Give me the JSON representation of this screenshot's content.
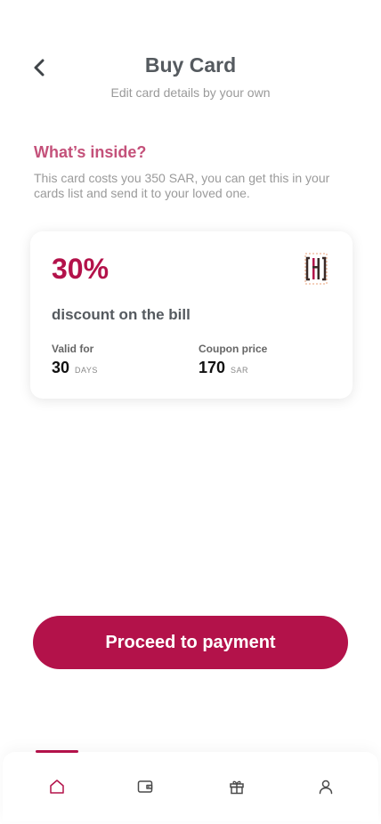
{
  "header": {
    "title": "Buy Card",
    "subtitle": "Edit card details by your own"
  },
  "info": {
    "heading": "What’s inside?",
    "description": "This card costs you 350 SAR, you can get this in your cards list and send it to your loved one."
  },
  "card": {
    "discount": "30%",
    "description": "discount on the bill",
    "validity": {
      "label": "Valid for",
      "value": "30",
      "unit": "DAYS"
    },
    "price": {
      "label": "Coupon price",
      "value": "170",
      "unit": "SAR"
    }
  },
  "actions": {
    "proceed_label": "Proceed to payment"
  },
  "tab_bar": {
    "active_tab": "home",
    "tabs": [
      "home-icon",
      "wallet-icon",
      "gift-icon",
      "profile-icon"
    ]
  },
  "colors": {
    "brand": "#b3124a",
    "heading_accent": "#c4517a",
    "text_dark": "#555a5f",
    "text_muted": "#9a9a9a"
  }
}
